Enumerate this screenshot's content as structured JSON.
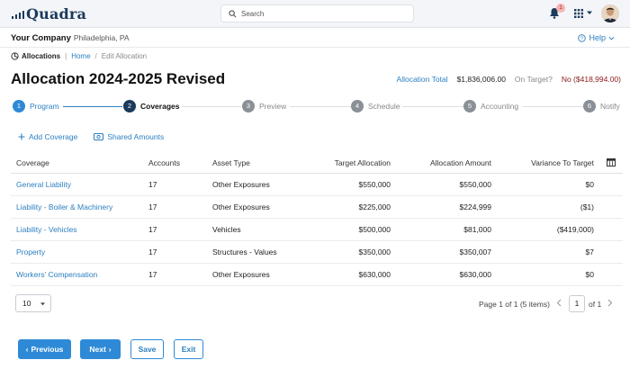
{
  "brand": {
    "name": "Quadra"
  },
  "search": {
    "placeholder": "Search"
  },
  "notifications": {
    "count": "1"
  },
  "company": {
    "name": "Your Company",
    "location": "Philadelphia, PA"
  },
  "help": {
    "label": "Help"
  },
  "breadcrumb": {
    "section": "Allocations",
    "home": "Home",
    "current": "Edit Allocation"
  },
  "page": {
    "title": "Allocation 2024-2025 Revised"
  },
  "totals": {
    "allocation_total_label": "Allocation Total",
    "allocation_total_value": "$1,836,006.00",
    "on_target_label": "On Target?",
    "on_target_value": "No ($418,994.00)"
  },
  "steps": [
    {
      "num": "1",
      "label": "Program",
      "state": "done"
    },
    {
      "num": "2",
      "label": "Coverages",
      "state": "active"
    },
    {
      "num": "3",
      "label": "Preview",
      "state": "todo"
    },
    {
      "num": "4",
      "label": "Schedule",
      "state": "todo"
    },
    {
      "num": "5",
      "label": "Accounting",
      "state": "todo"
    },
    {
      "num": "6",
      "label": "Notify",
      "state": "todo"
    }
  ],
  "actions": {
    "add_coverage": "Add Coverage",
    "shared_amounts": "Shared Amounts"
  },
  "table": {
    "headers": {
      "coverage": "Coverage",
      "accounts": "Accounts",
      "asset_type": "Asset Type",
      "target_allocation": "Target Allocation",
      "allocation_amount": "Allocation Amount",
      "variance": "Variance To Target"
    },
    "rows": [
      {
        "coverage": "General Liability",
        "accounts": "17",
        "asset_type": "Other Exposures",
        "target": "$550,000",
        "amount": "$550,000",
        "variance": "$0"
      },
      {
        "coverage": "Liability - Boiler & Machinery",
        "accounts": "17",
        "asset_type": "Other Exposures",
        "target": "$225,000",
        "amount": "$224,999",
        "variance": "($1)"
      },
      {
        "coverage": "Liability - Vehicles",
        "accounts": "17",
        "asset_type": "Vehicles",
        "target": "$500,000",
        "amount": "$81,000",
        "variance": "($419,000)"
      },
      {
        "coverage": "Property",
        "accounts": "17",
        "asset_type": "Structures - Values",
        "target": "$350,000",
        "amount": "$350,007",
        "variance": "$7"
      },
      {
        "coverage": "Workers' Compensation",
        "accounts": "17",
        "asset_type": "Other Exposures",
        "target": "$630,000",
        "amount": "$630,000",
        "variance": "$0"
      }
    ]
  },
  "pagination": {
    "per_page": "10",
    "info": "Page 1 of 1 (5 items)",
    "current": "1",
    "of_total": "of 1"
  },
  "buttons": {
    "previous": "Previous",
    "next": "Next",
    "save": "Save",
    "exit": "Exit"
  },
  "colors": {
    "accent": "#2e8ad6",
    "active_step": "#1b3a5c",
    "inactive_step": "#8a9096",
    "negative": "#8b1a1a"
  }
}
